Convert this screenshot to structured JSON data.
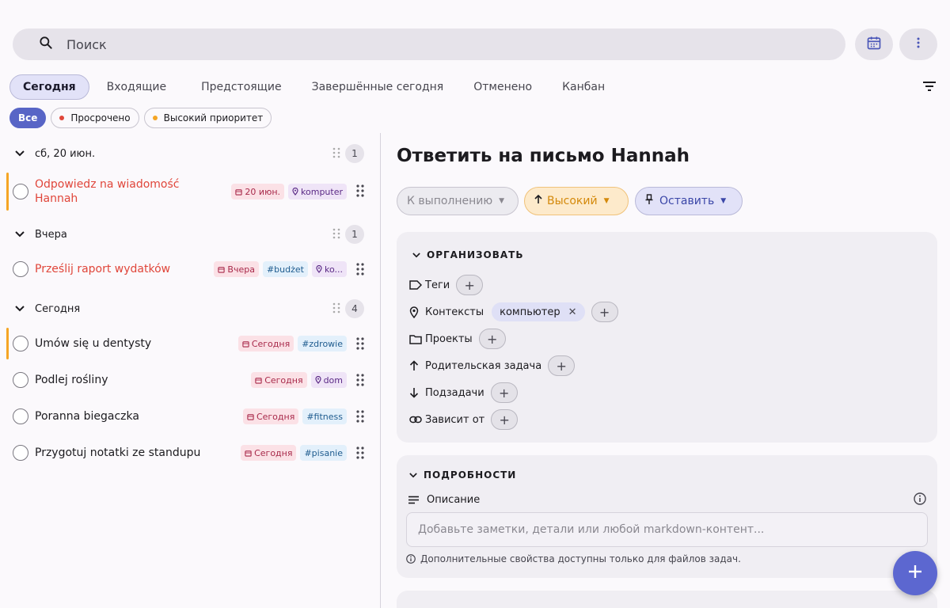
{
  "search": {
    "placeholder": "Поиск"
  },
  "tabs": [
    {
      "label": "Сегодня",
      "active": true
    },
    {
      "label": "Входящие"
    },
    {
      "label": "Предстоящие"
    },
    {
      "label": "Завершённые сегодня"
    },
    {
      "label": "Отменено"
    },
    {
      "label": "Канбан"
    }
  ],
  "filters": {
    "all": "Все",
    "overdue": "Просрочено",
    "high_priority": "Высокий приоритет"
  },
  "groups": [
    {
      "label": "сб, 20 июн.",
      "count": "1",
      "tasks": [
        {
          "title_line1": "Odpowiedz na wiadomość",
          "title_line2": "Hannah",
          "date": "20 июн.",
          "context": "komputer"
        }
      ]
    },
    {
      "label": "Вчера",
      "count": "1",
      "tasks": [
        {
          "title": "Prześlij raport wydatków",
          "date": "Вчера",
          "tag": "#budżet",
          "context": "ko..."
        }
      ]
    },
    {
      "label": "Сегодня",
      "count": "4",
      "tasks": [
        {
          "title": "Umów się u dentysty",
          "date": "Сегодня",
          "tag": "#zdrowie"
        },
        {
          "title": "Podlej rośliny",
          "date": "Сегодня",
          "context": "dom"
        },
        {
          "title": "Poranna biegaczka",
          "date": "Сегодня",
          "tag": "#fitness"
        },
        {
          "title": "Przygotuj notatki ze standupu",
          "date": "Сегодня",
          "tag": "#pisanie"
        }
      ]
    }
  ],
  "detail": {
    "title": "Ответить на письмо Hannah",
    "status": "К выполнению",
    "priority": "Высокий",
    "pin": "Оставить",
    "organize": {
      "heading": "ОРГАНИЗОВАТЬ",
      "tags": "Теги",
      "contexts": "Контексты",
      "context_value": "компьютер",
      "projects": "Проекты",
      "parent": "Родительская задача",
      "subtasks": "Подзадачи",
      "depends": "Зависит от"
    },
    "details": {
      "heading": "ПОДРОБНОСТИ",
      "description": "Описание",
      "placeholder": "Добавьте заметки, детали или любой markdown-контент...",
      "note": "Дополнительные свойства доступны только для файлов задач."
    }
  },
  "colors": {
    "accent": "#5865c6",
    "overdue": "#e0463a",
    "priority": "#f5a524"
  }
}
